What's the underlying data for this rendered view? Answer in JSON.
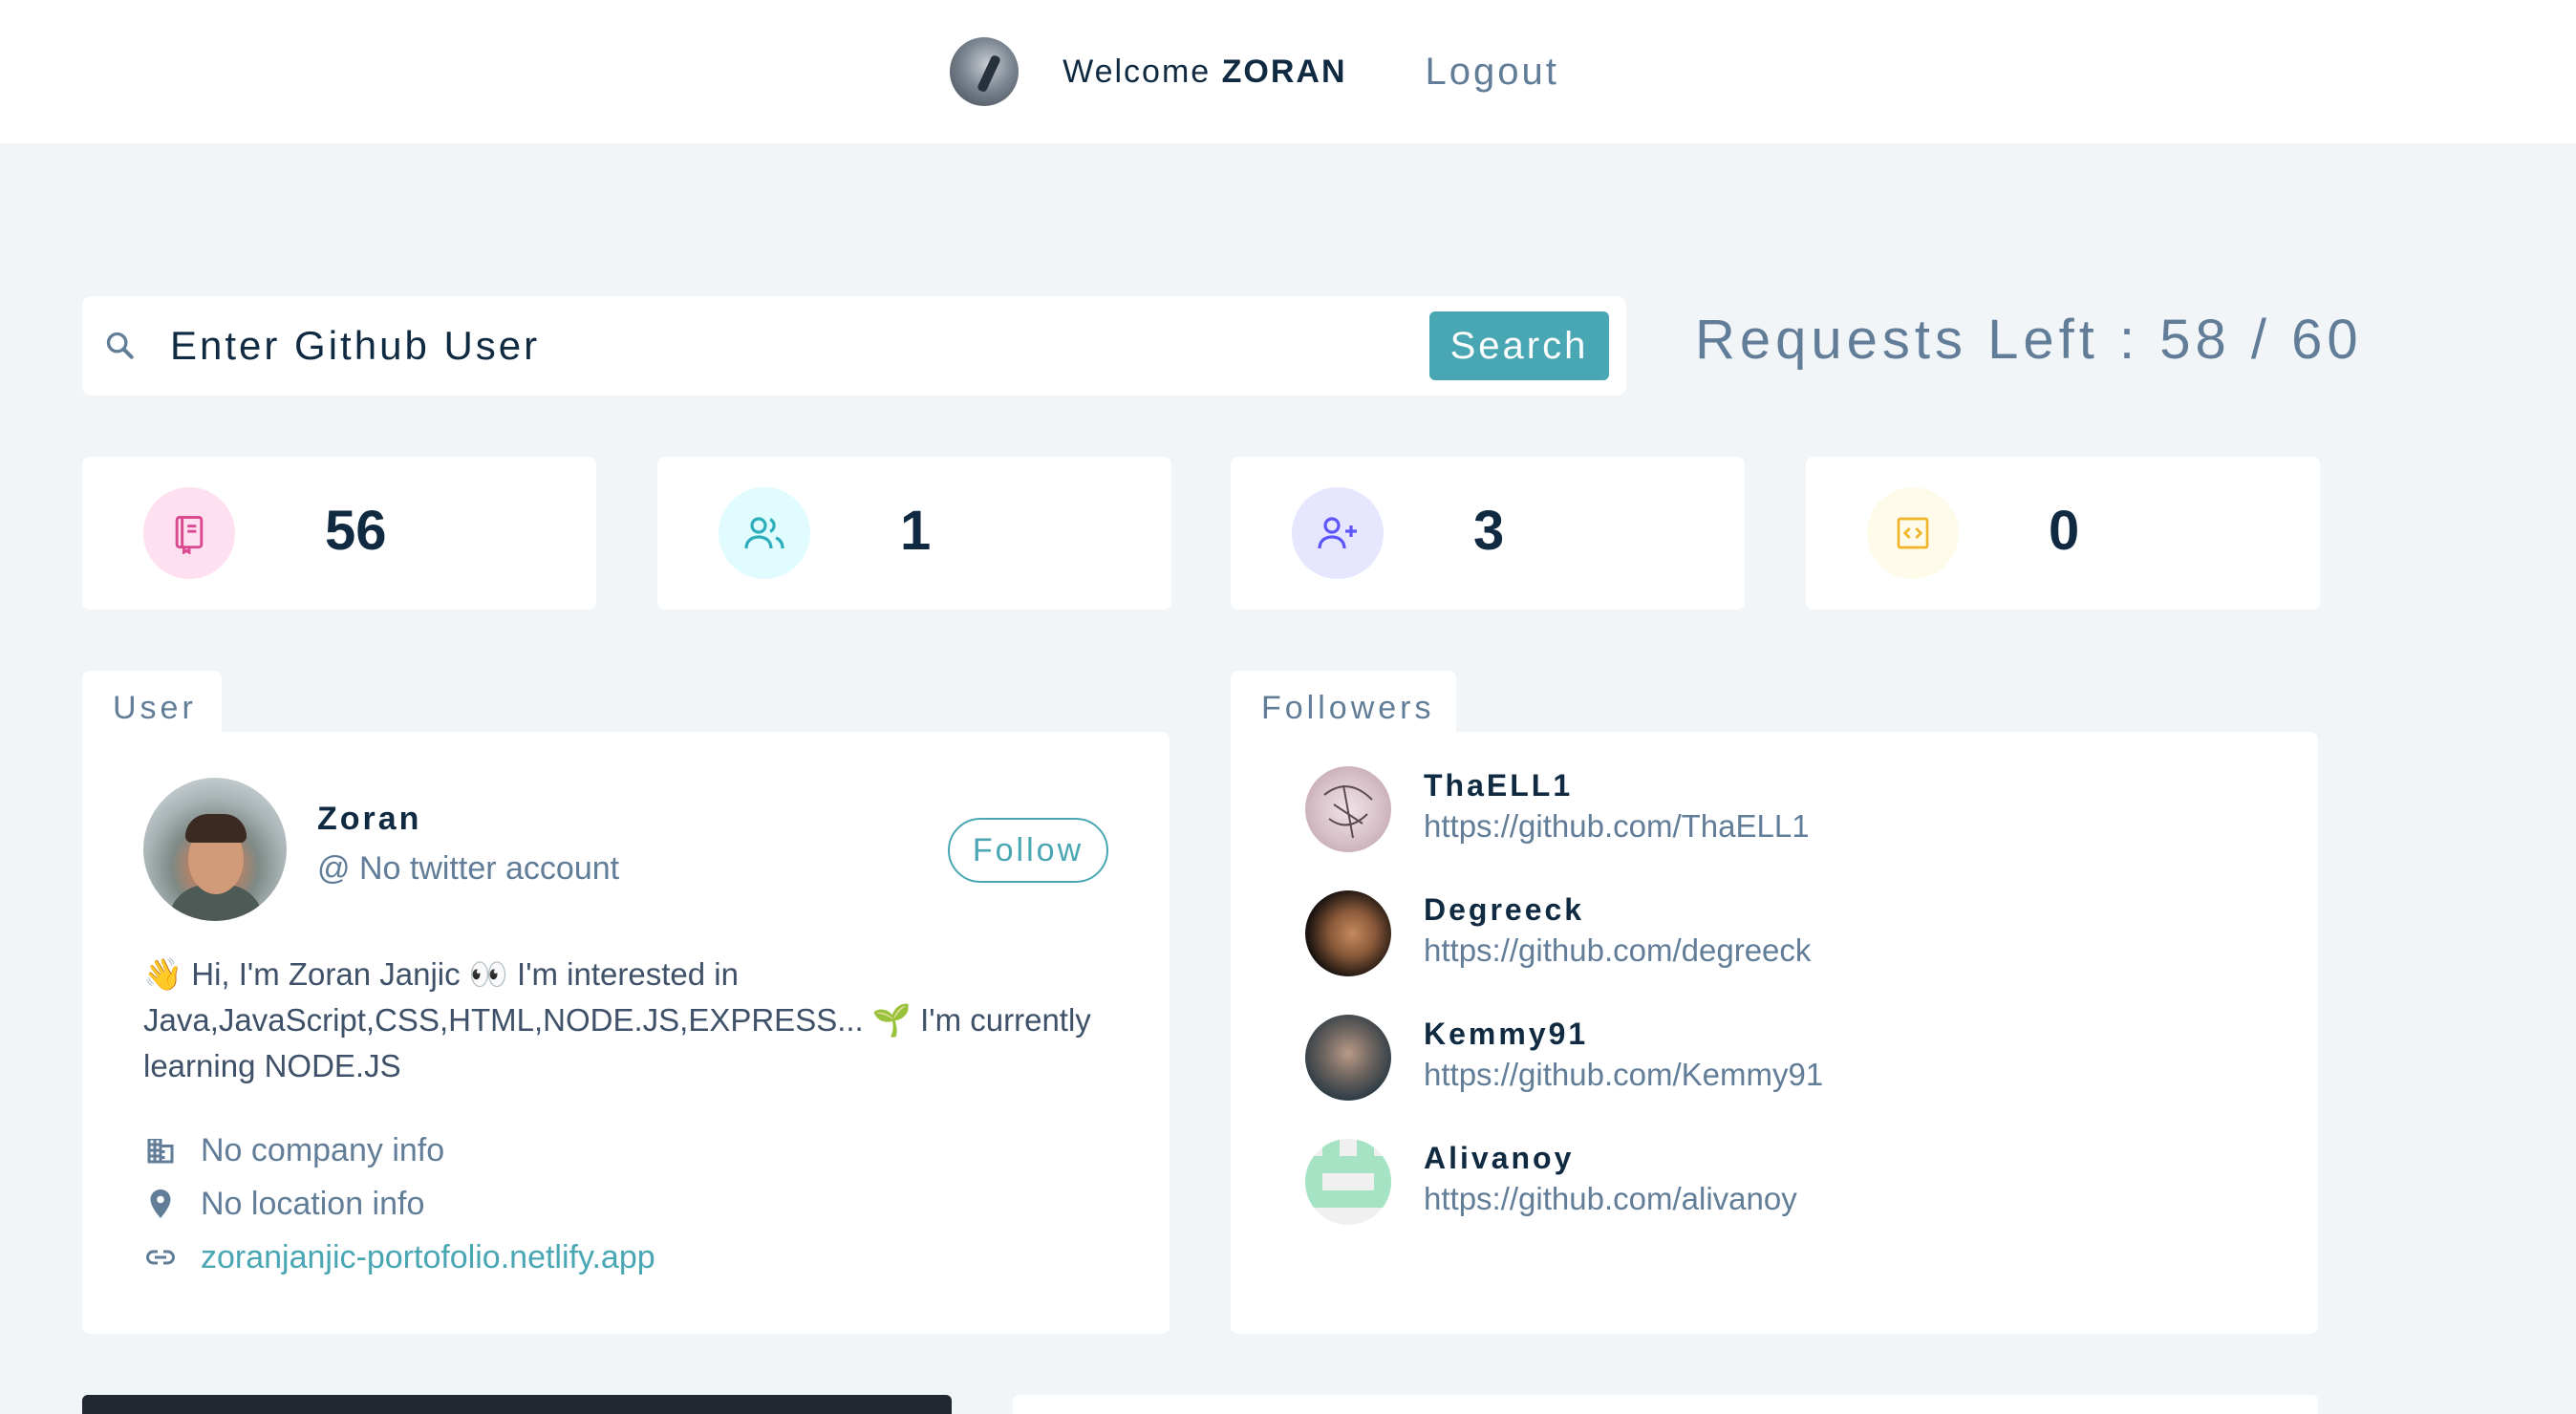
{
  "nav": {
    "welcome_prefix": "Welcome ",
    "username": "ZORAN",
    "logout_label": "Logout"
  },
  "search": {
    "placeholder": "Enter Github User",
    "button_label": "Search",
    "requests_label": "Requests Left : 58 / 60"
  },
  "stats": [
    {
      "icon": "repo-book-icon",
      "value": "56",
      "color": "#da4a91",
      "bg": "#ffe0f0"
    },
    {
      "icon": "users-icon",
      "value": "1",
      "color": "#2caeba",
      "bg": "#e0fcff"
    },
    {
      "icon": "user-plus-icon",
      "value": "3",
      "color": "#5d55fa",
      "bg": "#e6e6ff"
    },
    {
      "icon": "code-icon",
      "value": "0",
      "color": "#f0b429",
      "bg": "#fffbea"
    }
  ],
  "user_panel": {
    "tab_label": "User",
    "name": "Zoran",
    "twitter": "@ No twitter account",
    "follow_label": "Follow",
    "bio_line1": "👋 Hi, I'm Zoran Janjic 👀  I'm interested in",
    "bio_line2": "Java,JavaScript,CSS,HTML,NODE.JS,EXPRESS... 🌱  I'm currently",
    "bio_line3": "learning NODE.JS",
    "company": "No company info",
    "location": "No location info",
    "blog": "zoranjanjic-portofolio.netlify.app"
  },
  "followers_panel": {
    "tab_label": "Followers",
    "followers": [
      {
        "login": "ThaELL1",
        "url": "https://github.com/ThaELL1"
      },
      {
        "login": "Degreeck",
        "url": "https://github.com/degreeck"
      },
      {
        "login": "Kemmy91",
        "url": "https://github.com/Kemmy91"
      },
      {
        "login": "Alivanoy",
        "url": "https://github.com/alivanoy"
      }
    ]
  },
  "colors": {
    "accent": "#49a6b3",
    "background": "#f1f5f8",
    "text_dark": "#102a42",
    "text_muted": "#617d98"
  }
}
